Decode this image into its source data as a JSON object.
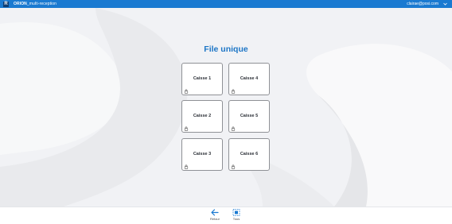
{
  "header": {
    "brand_bold": "ORION",
    "brand_rest": "_multi-reception",
    "user_email": "clairae@posi.com"
  },
  "main": {
    "title": "File unique",
    "tiles": [
      {
        "label": "Caisse 1"
      },
      {
        "label": "Caisse 4"
      },
      {
        "label": "Caisse 2"
      },
      {
        "label": "Caisse 5"
      },
      {
        "label": "Caisse 3"
      },
      {
        "label": "Caisse 6"
      }
    ]
  },
  "footer": {
    "back_label": "Retour",
    "all_label": "Tous"
  },
  "colors": {
    "accent": "#1a7ad1",
    "title": "#1d76c6"
  },
  "icons": {
    "tile_corner": "lock-icon",
    "back": "arrow-left-icon",
    "all": "select-all-icon"
  }
}
